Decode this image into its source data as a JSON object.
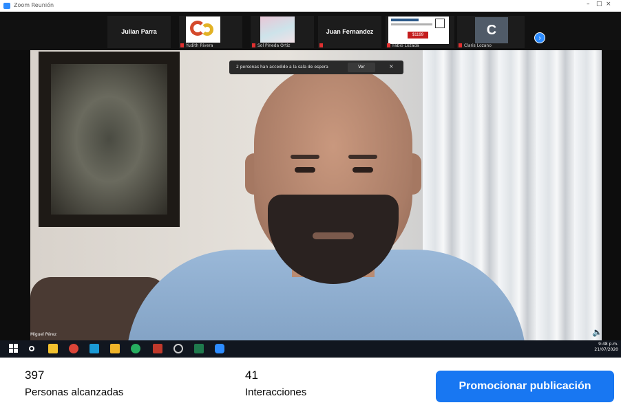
{
  "window": {
    "title": "Zoom Reunión",
    "controls": [
      "–",
      "□",
      "×"
    ]
  },
  "participants": [
    {
      "name": "Julian Parra",
      "label": "",
      "kind": "name-only"
    },
    {
      "name": "",
      "label": "Yudith Rivera",
      "kind": "logo"
    },
    {
      "name": "",
      "label": "Sol Pineda Ortiz",
      "kind": "pastel"
    },
    {
      "name": "Juan Fernandez",
      "label": "",
      "kind": "name-only"
    },
    {
      "name": "",
      "label": "Fabio Lozada",
      "kind": "slide",
      "slide_price": "$1199"
    },
    {
      "name": "C",
      "label": "Claris Lozano",
      "kind": "avatar"
    }
  ],
  "notice": {
    "text": "2 personas han accedido a la sala de espera",
    "view_label": "Ver",
    "close_label": "×"
  },
  "speaker_label": "Miguel Pérez",
  "taskbar": {
    "clock_time": "9:48 p.m.",
    "clock_date": "21/07/2020"
  },
  "stats": {
    "reach_value": "397",
    "reach_label": "Personas alcanzadas",
    "interactions_value": "41",
    "interactions_label": "Interacciones",
    "promote_label": "Promocionar publicación"
  },
  "colors": {
    "promote_button": "#1877f2",
    "zoom_blue": "#2d8cff"
  }
}
